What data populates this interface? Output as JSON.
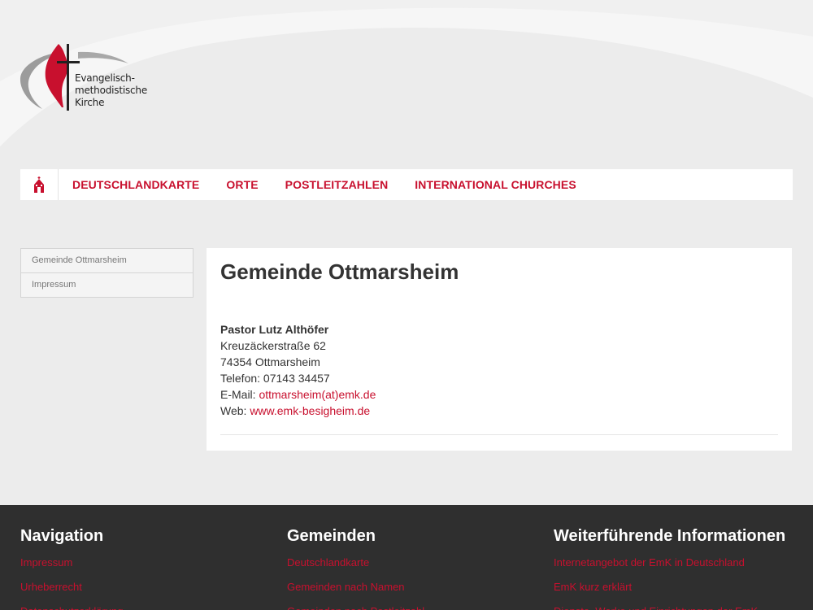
{
  "logo": {
    "line1": "Evangelisch-",
    "line2": "methodistische",
    "line3": "Kirche"
  },
  "nav": {
    "home_icon": "church-icon",
    "items": [
      "DEUTSCHLANDKARTE",
      "ORTE",
      "POSTLEITZAHLEN",
      "INTERNATIONAL CHURCHES"
    ]
  },
  "sidebar": {
    "items": [
      "Gemeinde Ottmarsheim",
      "Impressum"
    ]
  },
  "content": {
    "title": "Gemeinde Ottmarsheim",
    "pastor": "Pastor Lutz Althöfer",
    "street": "Kreuzäckerstraße 62",
    "city": "74354 Ottmarsheim",
    "phone": "Telefon: 07143 34457",
    "email_label": "E-Mail: ",
    "email": "ottmarsheim(at)emk.de",
    "web_label": "Web: ",
    "web": "www.emk-besigheim.de"
  },
  "footer": {
    "col1": {
      "title": "Navigation",
      "links": [
        "Impressum",
        "Urheberrecht",
        "Datenschutzerklärung"
      ]
    },
    "col2": {
      "title": "Gemeinden",
      "links": [
        "Deutschlandkarte",
        "Gemeinden nach Namen",
        "Gemeinden nach Postleitzahl"
      ]
    },
    "col3": {
      "title": "Weiterführende Informationen",
      "links": [
        "Internetangebot der EmK in Deutschland",
        "EmK kurz erklärt",
        "Dienste, Werke und Einrichtungen der EmK"
      ]
    }
  },
  "colors": {
    "accent": "#c8102e",
    "footer_bg": "#2f2f2f",
    "page_bg": "#ececec"
  }
}
